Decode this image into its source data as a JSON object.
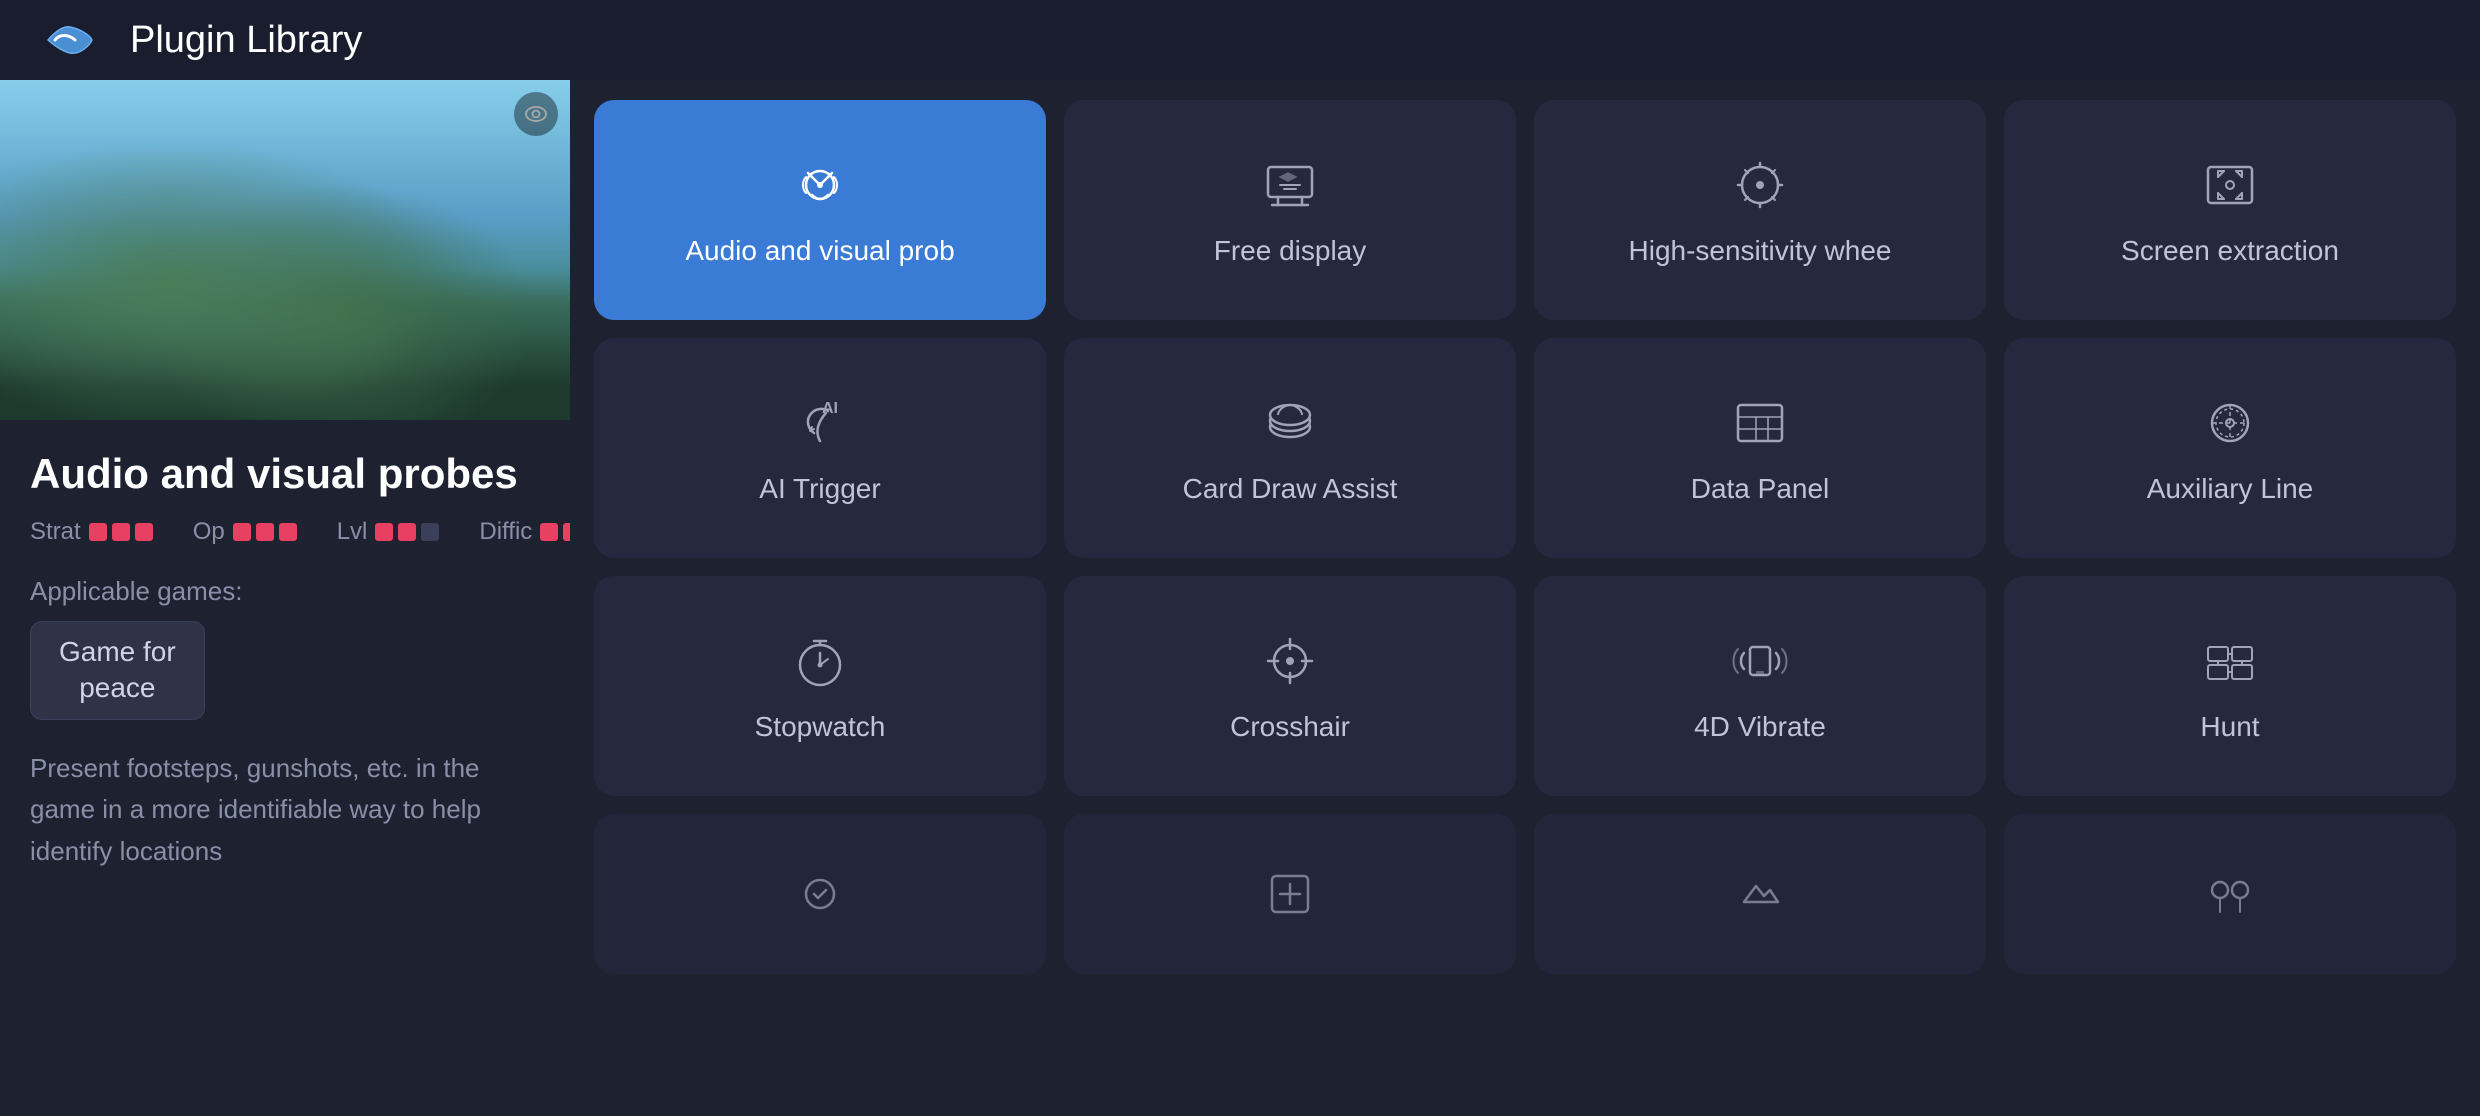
{
  "header": {
    "title": "Plugin Library"
  },
  "leftPanel": {
    "pluginName": "Audio and visual probes",
    "ratings": [
      {
        "label": "Strat",
        "key": "strat",
        "dots": [
          true,
          true,
          true,
          false,
          false
        ]
      },
      {
        "label": "Op",
        "key": "op",
        "dots": [
          true,
          true,
          true,
          false,
          false
        ]
      },
      {
        "label": "Lvl",
        "key": "lvl",
        "dots": [
          true,
          true,
          false,
          false,
          false
        ]
      },
      {
        "label": "Diffic",
        "key": "diffic",
        "dots": [
          true,
          true,
          false,
          false,
          false
        ]
      }
    ],
    "applicableLabel": "Applicable games:",
    "gameTag": "Game for\npeace",
    "description": "Present footsteps, gunshots, etc. in the game in a more identifiable way to help identify locations"
  },
  "pluginGrid": {
    "rows": [
      [
        {
          "id": "audio-visual",
          "label": "Audio and visual prob",
          "active": true,
          "icon": "audio"
        },
        {
          "id": "free-display",
          "label": "Free display",
          "active": false,
          "icon": "free-display"
        },
        {
          "id": "high-sensitivity",
          "label": "High-sensitivity whee",
          "active": false,
          "icon": "high-sens"
        },
        {
          "id": "screen-extraction",
          "label": "Screen extraction",
          "active": false,
          "icon": "screen-extract"
        }
      ],
      [
        {
          "id": "ai-trigger",
          "label": "AI Trigger",
          "active": false,
          "icon": "ai-trigger"
        },
        {
          "id": "card-draw",
          "label": "Card Draw Assist",
          "active": false,
          "icon": "card-draw"
        },
        {
          "id": "data-panel",
          "label": "Data Panel",
          "active": false,
          "icon": "data-panel"
        },
        {
          "id": "auxiliary-line",
          "label": "Auxiliary Line",
          "active": false,
          "icon": "auxiliary"
        }
      ],
      [
        {
          "id": "stopwatch",
          "label": "Stopwatch",
          "active": false,
          "icon": "stopwatch"
        },
        {
          "id": "crosshair",
          "label": "Crosshair",
          "active": false,
          "icon": "crosshair"
        },
        {
          "id": "4d-vibrate",
          "label": "4D Vibrate",
          "active": false,
          "icon": "vibrate"
        },
        {
          "id": "hunt",
          "label": "Hunt",
          "active": false,
          "icon": "hunt"
        }
      ],
      [
        {
          "id": "plugin-extra1",
          "label": "",
          "active": false,
          "icon": "generic1"
        },
        {
          "id": "plugin-extra2",
          "label": "",
          "active": false,
          "icon": "generic2"
        },
        {
          "id": "plugin-extra3",
          "label": "",
          "active": false,
          "icon": "generic3"
        },
        {
          "id": "plugin-extra4",
          "label": "",
          "active": false,
          "icon": "generic4"
        }
      ]
    ]
  }
}
